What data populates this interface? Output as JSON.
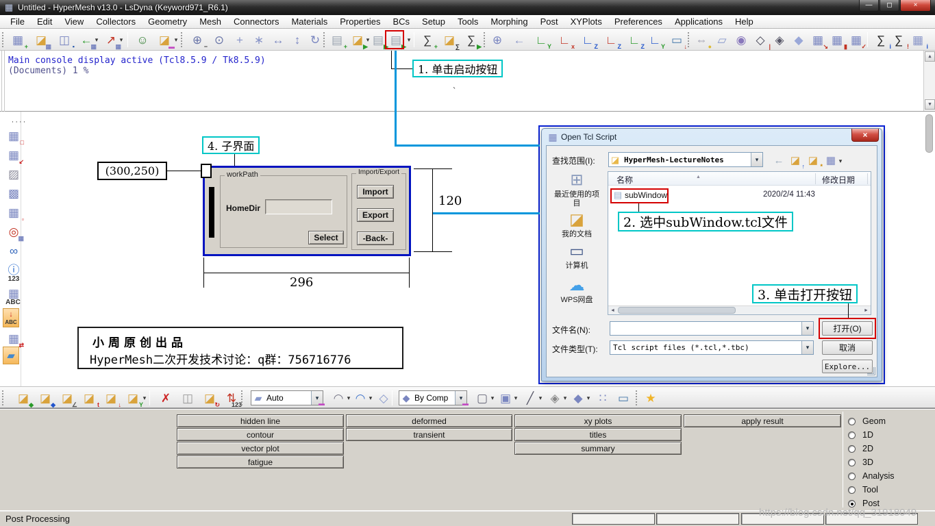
{
  "window": {
    "title": "Untitled - HyperMesh v13.0 - LsDyna (Keyword971_R6.1)"
  },
  "menu": {
    "items": [
      "File",
      "Edit",
      "View",
      "Collectors",
      "Geometry",
      "Mesh",
      "Connectors",
      "Materials",
      "Properties",
      "BCs",
      "Setup",
      "Tools",
      "Morphing",
      "Post",
      "XYPlots",
      "Preferences",
      "Applications",
      "Help"
    ]
  },
  "console": {
    "line1": "Main console display active (Tcl8.5.9 / Tk8.5.9)",
    "line2": "(Documents) 1 %",
    "cursor": "`"
  },
  "annotations": {
    "step1": "1. 单击启动按钮",
    "step2": "2. 选中subWindow.tcl文件",
    "step3": "3. 单击打开按钮",
    "step4": "4. 子界面",
    "coord": "(300,250)",
    "width": "296",
    "height": "120"
  },
  "subwindow": {
    "workpath_group": "workPath",
    "homedir_label": "HomeDir",
    "select_button": "Select",
    "importexport_group": "Import/Export",
    "import_button": "Import",
    "export_button": "Export",
    "back_button": "-Back-"
  },
  "credit": {
    "line1": "小周原创出品",
    "line2": "HyperMesh二次开发技术讨论：q群：756716776"
  },
  "dialog": {
    "title": "Open Tcl Script",
    "look_in_label": "查找范围(I):",
    "look_in_value": "HyperMesh-LectureNotes",
    "col_name": "名称",
    "col_date": "修改日期",
    "file_name": "subWindow",
    "file_date": "2020/2/4 11:43",
    "places": [
      "最近使用的项目",
      "我的文档",
      "计算机",
      "WPS网盘"
    ],
    "filename_label": "文件名(N):",
    "filename_value": "",
    "filetype_label": "文件类型(T):",
    "filetype_value": "Tcl script files (*.tcl,*.tbc)",
    "open_button": "打开(O)",
    "cancel_button": "取消",
    "explore_button": "Explore..."
  },
  "left_toolbar": {
    "info_label": "123",
    "numbers_label": "ABC",
    "annotate_label": "ABC"
  },
  "toolbar2": {
    "display_mode": "Auto",
    "color_mode": "By Comp"
  },
  "panel": {
    "col1": [
      "hidden line",
      "contour",
      "vector plot",
      "fatigue"
    ],
    "col2": [
      "deformed",
      "transient"
    ],
    "col3": [
      "xy plots",
      "titles",
      "summary"
    ],
    "col4": [
      "apply result"
    ],
    "radios": [
      "Geom",
      "1D",
      "2D",
      "3D",
      "Analysis",
      "Tool",
      "Post"
    ],
    "selected_radio": "Post"
  },
  "status": {
    "mode": "Post Processing",
    "watermark": "https://blog.csdn.net/qq_31918049"
  },
  "colors": {
    "accent_blue_line": "#0096dc",
    "annotation_cyan": "#00c6c6",
    "highlight_red": "#d40000",
    "diagram_blue": "#0013c0"
  },
  "icons": {
    "app": {
      "g": "▦",
      "c": "#b8c4e0"
    },
    "win_min": {
      "g": "—",
      "c": "#fff"
    },
    "win_restore": {
      "g": "◻",
      "c": "#fff"
    },
    "win_close": {
      "g": "×",
      "c": "#fff"
    },
    "new_session": {
      "g": "▦",
      "c": "#7a86c0",
      "b": "+",
      "bc": "#2a9a2a"
    },
    "open_model": {
      "g": "◪",
      "c": "#d9a33c",
      "b": "▦",
      "bc": "#7a86c0"
    },
    "save_model": {
      "g": "◫",
      "c": "#7a86c0",
      "b": "▪",
      "bc": "#2255aa"
    },
    "import_model": {
      "g": "←",
      "c": "#2a9a2a",
      "b": "▦",
      "bc": "#7a86c0"
    },
    "export_model": {
      "g": "↗",
      "c": "#c23222",
      "b": "▦",
      "bc": "#7a86c0"
    },
    "user_profile": {
      "g": "☺",
      "c": "#2a7a2a"
    },
    "organize_collectors": {
      "g": "◪",
      "c": "#d9a33c",
      "b": "▬",
      "bc": "#c24ac2"
    },
    "zoom_in_out": {
      "g": "⊕",
      "c": "#6a76a8",
      "b": "−",
      "bc": "#333"
    },
    "zoom_lasso": {
      "g": "⊙",
      "c": "#6a76a8"
    },
    "fit_view": {
      "g": "+",
      "c": "#8a96c8"
    },
    "pan_view": {
      "g": "∗",
      "c": "#8a96c8"
    },
    "rotate_lr": {
      "g": "↔",
      "c": "#7a86c0"
    },
    "rotate_ud": {
      "g": "↕",
      "c": "#7a86c0"
    },
    "rotate_free": {
      "g": "↻",
      "c": "#7a86c0"
    },
    "new_script": {
      "g": "▤",
      "c": "#9aa4b0",
      "b": "+",
      "bc": "#2a9a2a"
    },
    "open_script": {
      "g": "◪",
      "c": "#d9a33c",
      "b": "▶",
      "bc": "#2a9a2a"
    },
    "run_current_script": {
      "g": "▤",
      "c": "#9aa4b0",
      "b": "▶",
      "bc": "#2a9a2a"
    },
    "run_script": {
      "g": "▤",
      "c": "#9aa4b0",
      "b": "▶",
      "bc": "#2a9a2a"
    },
    "new_summary": {
      "g": "∑",
      "c": "#333",
      "b": "+",
      "bc": "#2a9a2a"
    },
    "open_summary": {
      "g": "◪",
      "c": "#d9a33c",
      "b": "∑",
      "bc": "#333"
    },
    "run_summary": {
      "g": "∑",
      "c": "#333",
      "b": "▶",
      "bc": "#2a9a2a"
    },
    "zoom_window": {
      "g": "⊕",
      "c": "#7a86c0"
    },
    "previous_view": {
      "g": "←",
      "c": "#8a96c8"
    },
    "axis_yx": {
      "g": "∟",
      "c": "#2a9a2a",
      "b": "Y",
      "bc": "#2a9a2a"
    },
    "axis_xy": {
      "g": "∟",
      "c": "#c23222",
      "b": "x",
      "bc": "#c23222"
    },
    "axis_zx": {
      "g": "∟",
      "c": "#2255cc",
      "b": "Z",
      "bc": "#2255cc"
    },
    "axis_xz": {
      "g": "∟",
      "c": "#c23222",
      "b": "Z",
      "bc": "#2255cc"
    },
    "axis_zy": {
      "g": "∟",
      "c": "#2a9a2a",
      "b": "Z",
      "bc": "#2255cc"
    },
    "axis_yz": {
      "g": "∟",
      "c": "#2255cc",
      "b": "Y",
      "bc": "#2a9a2a"
    },
    "screen_capture": {
      "g": "▭",
      "c": "#4477aa",
      "b": "↓",
      "bc": "#c23222"
    },
    "measure_distance": {
      "g": "⇔",
      "c": "#99a",
      "b": "●",
      "bc": "#ddbb33"
    },
    "ruler": {
      "g": "▱",
      "c": "#8899cc"
    },
    "mass_calc": {
      "g": "◉",
      "c": "#8877bb"
    },
    "cube_edge": {
      "g": "◇",
      "c": "#445",
      "b": "|",
      "bc": "#c23222"
    },
    "cube_faces": {
      "g": "◈",
      "c": "#556"
    },
    "cube_solid": {
      "g": "◆",
      "c": "#9aa8d8"
    },
    "panel_to_view": {
      "g": "▦",
      "c": "#7a86c0",
      "b": "↘",
      "bc": "#c23222"
    },
    "section_cut": {
      "g": "▦",
      "c": "#7a86c0",
      "b": "▮",
      "bc": "#c23222"
    },
    "model_check": {
      "g": "▦",
      "c": "#7a86c0",
      "b": "✓",
      "bc": "#c23222"
    },
    "summary_info": {
      "g": "∑",
      "c": "#222",
      "b": "i",
      "bc": "#2255cc"
    },
    "summary_loads": {
      "g": "∑",
      "c": "#222",
      "b": "!",
      "bc": "#c23222"
    },
    "calculator": {
      "g": "▦",
      "c": "#8a96c8",
      "b": "i",
      "bc": "#2255cc"
    },
    "lt_handle": {
      "g": "····",
      "c": "#333"
    },
    "lt_mask": {
      "g": "▦",
      "c": "#7a86c0",
      "b": "□",
      "bc": "#c22"
    },
    "lt_reverse": {
      "g": "▦",
      "c": "#7a86c0",
      "b": "↙",
      "bc": "#c22"
    },
    "lt_wireframe": {
      "g": "▨",
      "c": "#8a8a9a"
    },
    "lt_shaded": {
      "g": "▩",
      "c": "#7a86c0"
    },
    "lt_maskbox": {
      "g": "▦",
      "c": "#7a86c0",
      "b": "▫",
      "bc": "#c22"
    },
    "lt_sphere_clip": {
      "g": "◎",
      "c": "#c23222",
      "b": "▦",
      "bc": "#7a86c0"
    },
    "lt_find": {
      "g": "∞",
      "c": "#3366bb"
    },
    "lt_info": {
      "g": "ⓘ",
      "c": "#2266cc"
    },
    "lt_numbers": {
      "g": "▦",
      "c": "#7a86c0"
    },
    "lt_annotate_arrow": {
      "g": "↓",
      "c": "#c22"
    },
    "lt_arrange": {
      "g": "▦",
      "c": "#7a86c0",
      "b": "⇄",
      "bc": "#c22"
    },
    "lt_surface_edit": {
      "g": "▰",
      "c": "#4488cc"
    },
    "bt_folder_geom": {
      "g": "◪",
      "c": "#d9a33c",
      "b": "◆",
      "bc": "#2a9a2a"
    },
    "bt_folder_comp": {
      "g": "◪",
      "c": "#d9a33c",
      "b": "◆",
      "bc": "#2255cc"
    },
    "bt_folder_section": {
      "g": "◪",
      "c": "#d9a33c",
      "b": "∠",
      "bc": "#555"
    },
    "bt_folder_systems": {
      "g": "◪",
      "c": "#d9a33c",
      "b": "t",
      "bc": "#c22"
    },
    "bt_folder_loads": {
      "g": "◪",
      "c": "#d9a33c",
      "b": "↓",
      "bc": "#c22"
    },
    "bt_folder_axes": {
      "g": "◪",
      "c": "#d9a33c",
      "b": "Y",
      "bc": "#2a9a2a"
    },
    "bt_delete": {
      "g": "✗",
      "c": "#c22"
    },
    "bt_layers": {
      "g": "◫",
      "c": "#999"
    },
    "bt_organize": {
      "g": "◪",
      "c": "#d9a33c",
      "b": "↻",
      "bc": "#c22"
    },
    "bt_renumber": {
      "g": "⇅",
      "c": "#c23222",
      "b": "123",
      "bc": "#333"
    },
    "bt_display_geom": {
      "g": "▰",
      "c": "#8899cc",
      "b": "▬",
      "bc": "#c24ac2"
    },
    "bt_surf_wire": {
      "g": "◠",
      "c": "#778"
    },
    "bt_surf_shade": {
      "g": "◠",
      "c": "#4477cc"
    },
    "bt_cube_trans": {
      "g": "◇",
      "c": "#8899cc"
    },
    "bt_bycomp": {
      "g": "◆",
      "c": "#7a86c0",
      "b": "▬",
      "bc": "#c24ac2"
    },
    "bt_elem_wire": {
      "g": "▢",
      "c": "#667"
    },
    "bt_elem_shade": {
      "g": "▣",
      "c": "#7a86c0"
    },
    "bt_line": {
      "g": "╱",
      "c": "#556"
    },
    "bt_elem_flat": {
      "g": "◈",
      "c": "#888"
    },
    "bt_elem_solid": {
      "g": "◆",
      "c": "#7a86c0"
    },
    "bt_scatter": {
      "g": "∷",
      "c": "#7a86c0"
    },
    "bt_monitor": {
      "g": "▭",
      "c": "#4477aa"
    },
    "bt_star": {
      "g": "★",
      "c": "#f0b428"
    },
    "dlg_app": {
      "g": "▦",
      "c": "#7a86c0"
    },
    "dlg_close": {
      "g": "×",
      "c": "#fff"
    },
    "dlg_folder": {
      "g": "◪",
      "c": "#e8b84a"
    },
    "dlg_back": {
      "g": "←",
      "c": "#9ab"
    },
    "dlg_up": {
      "g": "◪",
      "c": "#d9a33c",
      "b": "↑",
      "bc": "#2255cc"
    },
    "dlg_newfolder": {
      "g": "◪",
      "c": "#d9a33c",
      "b": "*",
      "bc": "#cc8800"
    },
    "dlg_views": {
      "g": "▦",
      "c": "#7a86c0"
    },
    "dlg_file": {
      "g": "▤",
      "c": "#9ab0cc"
    },
    "pl_recent": {
      "g": "⊞",
      "c": "#8899bb"
    },
    "pl_docs": {
      "g": "◪",
      "c": "#d9a33c"
    },
    "pl_computer": {
      "g": "▭",
      "c": "#445a8a"
    },
    "pl_wps": {
      "g": "☁",
      "c": "#44a0e8"
    },
    "sb_up": {
      "g": "▲",
      "c": "#556"
    },
    "sb_down": {
      "g": "▼",
      "c": "#556"
    },
    "sb_left": {
      "g": "◄",
      "c": "#556"
    },
    "sb_right": {
      "g": "►",
      "c": "#556"
    }
  }
}
